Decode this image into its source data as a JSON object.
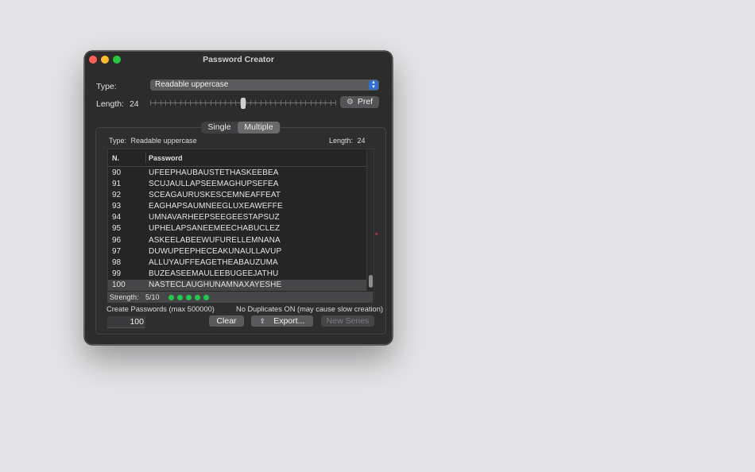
{
  "window": {
    "title": "Password Creator"
  },
  "controls": {
    "type_label": "Type:",
    "type_value": "Readable uppercase",
    "length_label": "Length:",
    "length_value": "24",
    "slider_fraction": 0.5,
    "pref_label": "Pref"
  },
  "segment": {
    "single": "Single",
    "multiple": "Multiple",
    "selected": "Multiple"
  },
  "info": {
    "type_label": "Type:",
    "type_value": "Readable uppercase",
    "length_label": "Length:",
    "length_value": "24"
  },
  "table": {
    "headers": [
      "N.",
      "Password"
    ],
    "rows": [
      {
        "n": "90",
        "password": "UFEEPHAUBAUSTETHASKEEBEA"
      },
      {
        "n": "91",
        "password": "SCUJAULLAPSEEMAGHUPSEFEA"
      },
      {
        "n": "92",
        "password": "SCEAGAURUSKESCEMNEAFFEAT"
      },
      {
        "n": "93",
        "password": "EAGHAPSAUMNEEGLUXEAWEFFE"
      },
      {
        "n": "94",
        "password": "UMNAVARHEEPSEEGEESTAPSUZ"
      },
      {
        "n": "95",
        "password": "UPHELAPSANEEMEECHABUCLEZ"
      },
      {
        "n": "96",
        "password": "ASKEELABEEWUFURELLEMNANA"
      },
      {
        "n": "97",
        "password": "DUWUPEEPHECEAKUNAULLAVUP"
      },
      {
        "n": "98",
        "password": "ALLUYAUFFEAGETHEABAUZUMA"
      },
      {
        "n": "99",
        "password": "BUZEASEEMAULEEBUGEEJATHU"
      },
      {
        "n": "100",
        "password": "NASTECLAUGHUNAMNAXAYESHE"
      }
    ],
    "selected_row": "100"
  },
  "strength": {
    "label": "Strength:",
    "value": "5/10",
    "dots": 5,
    "dot_color": "#22c94a"
  },
  "footer": {
    "create_label": "Create Passwords (max 500000)",
    "no_duplicates": "No Duplicates ON (may cause slow creation)",
    "count_value": "100",
    "clear_label": "Clear",
    "export_label": "Export...",
    "new_series_label": "New Series"
  },
  "icons": {
    "pref": "gear-icon",
    "export": "share-icon",
    "type_select": "chevron-up-down-icon"
  }
}
